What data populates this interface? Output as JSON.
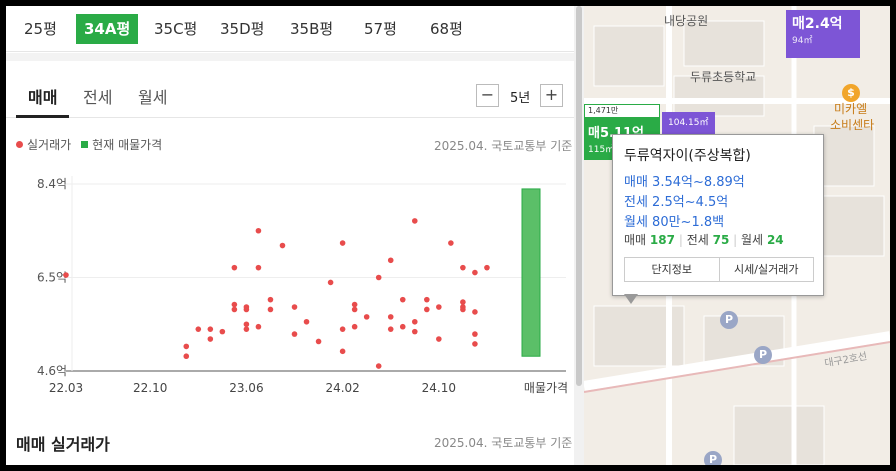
{
  "area_tabs": [
    "25평",
    "34A평",
    "35C평",
    "35D평",
    "35B평",
    "57평",
    "68평"
  ],
  "active_area_tab": "34A평",
  "deal_tabs": [
    "매매",
    "전세",
    "월세"
  ],
  "period": "5년",
  "legend": {
    "actual": "실거래가",
    "current": "현재 매물가격"
  },
  "source_note": "2025.04. 국토교통부 기준",
  "section_title": "매매 실거래가",
  "chart_data": {
    "type": "scatter",
    "y_tick_labels": [
      "8.4억",
      "6.5억",
      "4.6억"
    ],
    "ylim": [
      4.6,
      8.4
    ],
    "x_tick_labels": [
      "22.03",
      "22.10",
      "23.06",
      "24.02",
      "24.10",
      "매물가격"
    ],
    "x_range": [
      "2022-03",
      "2025-04"
    ],
    "series": [
      {
        "name": "실거래가",
        "x": [
          "2022-03",
          "2023-01",
          "2023-01",
          "2023-02",
          "2023-03",
          "2023-03",
          "2023-04",
          "2023-05",
          "2023-05",
          "2023-05",
          "2023-06",
          "2023-06",
          "2023-06",
          "2023-06",
          "2023-07",
          "2023-07",
          "2023-07",
          "2023-08",
          "2023-08",
          "2023-09",
          "2023-10",
          "2023-10",
          "2023-11",
          "2023-12",
          "2024-01",
          "2024-02",
          "2024-02",
          "2024-02",
          "2024-03",
          "2024-03",
          "2024-03",
          "2024-04",
          "2024-05",
          "2024-05",
          "2024-06",
          "2024-06",
          "2024-06",
          "2024-07",
          "2024-07",
          "2024-08",
          "2024-08",
          "2024-08",
          "2024-09",
          "2024-09",
          "2024-10",
          "2024-10",
          "2024-11",
          "2024-12",
          "2024-12",
          "2024-12",
          "2024-12",
          "2025-01",
          "2025-01",
          "2025-01",
          "2025-01",
          "2025-02"
        ],
        "values": [
          6.55,
          4.9,
          5.1,
          5.45,
          5.45,
          5.25,
          5.4,
          6.7,
          5.95,
          5.85,
          5.55,
          5.45,
          5.9,
          5.85,
          7.45,
          6.7,
          5.5,
          5.85,
          6.05,
          7.15,
          5.9,
          5.35,
          5.6,
          5.2,
          6.4,
          7.2,
          5.45,
          5.0,
          5.95,
          5.85,
          5.5,
          5.7,
          6.5,
          4.7,
          5.7,
          5.45,
          6.85,
          5.5,
          6.05,
          7.65,
          5.4,
          5.6,
          6.05,
          5.85,
          5.9,
          5.25,
          7.2,
          6.0,
          5.85,
          6.7,
          5.9,
          5.35,
          5.15,
          5.8,
          6.6,
          6.7
        ]
      }
    ],
    "current_listing_range": [
      4.9,
      8.3
    ]
  },
  "map": {
    "labels": [
      "내당공원",
      "두류초등학교",
      "미카엘",
      "소비센타",
      "대구2호선"
    ],
    "tags": [
      {
        "text": "매2.4억",
        "sub": "94㎡"
      },
      {
        "text": "104.15㎡"
      },
      {
        "text": "1,471만"
      },
      {
        "text": "매5.11억"
      },
      {
        "text": "115㎡"
      }
    ],
    "popup": {
      "title": "두류역자이(주상복합)",
      "sale": "매매 3.54억~8.89억",
      "jeonse": "전세 2.5억~4.5억",
      "monthly": "월세 80만~1.8백",
      "count_sale_label": "매매",
      "count_sale": "187",
      "count_jeonse_label": "전세",
      "count_jeonse": "75",
      "count_monthly_label": "월세",
      "count_monthly": "24",
      "btn_info": "단지정보",
      "btn_price": "시세/실거래가"
    }
  }
}
